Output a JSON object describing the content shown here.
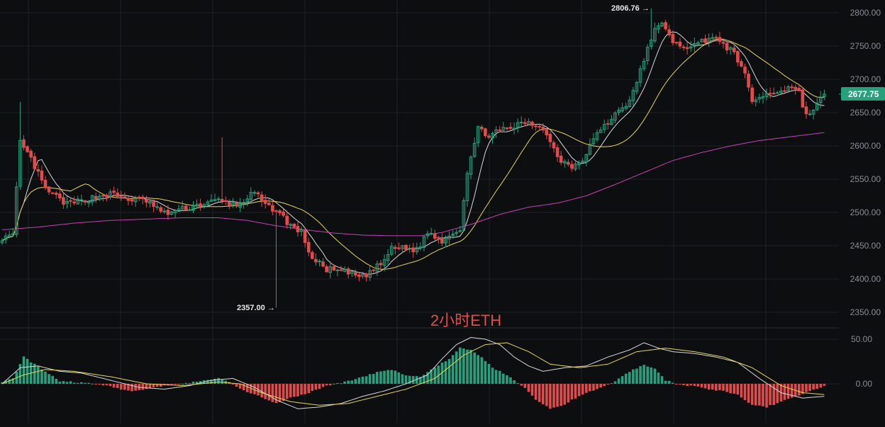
{
  "chart_data": {
    "type": "candlestick",
    "title": "2小时ETH",
    "colors": {
      "background": "#0d0e10",
      "grid": "#1e2024",
      "up": "#26a17b",
      "down": "#e04b4b",
      "ma_fast": "#d8d8d8",
      "ma_mid": "#e8d44d",
      "ma_slow": "#c740b8",
      "axis_text": "#8a8d93",
      "title": "#e04b4b"
    },
    "price_axis": {
      "ticks": [
        "2800.00",
        "2750.00",
        "2700.00",
        "2650.00",
        "2600.00",
        "2550.00",
        "2500.00",
        "2450.00",
        "2400.00",
        "2350.00"
      ],
      "ylim": [
        2326,
        2815
      ]
    },
    "macd_axis": {
      "ticks": [
        "50.00",
        "0.00"
      ],
      "ylim": [
        -38,
        65
      ]
    },
    "annotations": {
      "high_label": "2806.76 →",
      "low_label": "2357.00 →",
      "current_price": "2677.75"
    },
    "key_prices": {
      "high": 2806.76,
      "low": 2357.0,
      "current": 2677.75
    },
    "close_path": [
      [
        0,
        2462
      ],
      [
        3,
        2464
      ],
      [
        5,
        2605
      ],
      [
        8,
        2580
      ],
      [
        12,
        2535
      ],
      [
        18,
        2512
      ],
      [
        25,
        2522
      ],
      [
        30,
        2528
      ],
      [
        35,
        2520
      ],
      [
        40,
        2518
      ],
      [
        45,
        2498
      ],
      [
        50,
        2505
      ],
      [
        55,
        2512
      ],
      [
        60,
        2518
      ],
      [
        65,
        2510
      ],
      [
        70,
        2530
      ],
      [
        73,
        2510
      ],
      [
        76,
        2504
      ],
      [
        80,
        2480
      ],
      [
        83,
        2470
      ],
      [
        86,
        2430
      ],
      [
        90,
        2415
      ],
      [
        95,
        2410
      ],
      [
        100,
        2403
      ],
      [
        105,
        2422
      ],
      [
        108,
        2445
      ],
      [
        111,
        2448
      ],
      [
        115,
        2443
      ],
      [
        118,
        2470
      ],
      [
        122,
        2458
      ],
      [
        125,
        2470
      ],
      [
        127,
        2476
      ],
      [
        129,
        2562
      ],
      [
        132,
        2625
      ],
      [
        135,
        2617
      ],
      [
        140,
        2625
      ],
      [
        145,
        2635
      ],
      [
        150,
        2628
      ],
      [
        152,
        2605
      ],
      [
        155,
        2578
      ],
      [
        158,
        2570
      ],
      [
        161,
        2580
      ],
      [
        164,
        2612
      ],
      [
        168,
        2635
      ],
      [
        172,
        2660
      ],
      [
        174,
        2665
      ],
      [
        176,
        2697
      ],
      [
        178,
        2730
      ],
      [
        181,
        2773
      ],
      [
        183,
        2788
      ],
      [
        186,
        2752
      ],
      [
        188,
        2752
      ],
      [
        191,
        2748
      ],
      [
        194,
        2757
      ],
      [
        197,
        2765
      ],
      [
        200,
        2750
      ],
      [
        203,
        2742
      ],
      [
        206,
        2705
      ],
      [
        208,
        2668
      ],
      [
        211,
        2675
      ],
      [
        214,
        2680
      ],
      [
        217,
        2685
      ],
      [
        219,
        2690
      ],
      [
        221,
        2680
      ],
      [
        223,
        2645
      ],
      [
        225,
        2655
      ],
      [
        228,
        2677.75
      ]
    ],
    "macd_histogram_path": [
      [
        0,
        2
      ],
      [
        3,
        6
      ],
      [
        6,
        30
      ],
      [
        9,
        22
      ],
      [
        12,
        14
      ],
      [
        16,
        3
      ],
      [
        20,
        2
      ],
      [
        25,
        0
      ],
      [
        30,
        -3
      ],
      [
        35,
        -8
      ],
      [
        40,
        -6
      ],
      [
        45,
        -2
      ],
      [
        50,
        0
      ],
      [
        55,
        3
      ],
      [
        60,
        6
      ],
      [
        63,
        2
      ],
      [
        66,
        -6
      ],
      [
        70,
        -12
      ],
      [
        73,
        -17
      ],
      [
        76,
        -22
      ],
      [
        80,
        -16
      ],
      [
        85,
        -10
      ],
      [
        90,
        -2
      ],
      [
        95,
        2
      ],
      [
        100,
        8
      ],
      [
        105,
        14
      ],
      [
        108,
        16
      ],
      [
        112,
        9
      ],
      [
        116,
        8
      ],
      [
        120,
        18
      ],
      [
        124,
        28
      ],
      [
        127,
        40
      ],
      [
        130,
        38
      ],
      [
        133,
        30
      ],
      [
        136,
        18
      ],
      [
        140,
        10
      ],
      [
        145,
        -5
      ],
      [
        148,
        -18
      ],
      [
        152,
        -28
      ],
      [
        155,
        -25
      ],
      [
        158,
        -18
      ],
      [
        162,
        -10
      ],
      [
        166,
        -4
      ],
      [
        170,
        3
      ],
      [
        174,
        14
      ],
      [
        178,
        21
      ],
      [
        181,
        17
      ],
      [
        184,
        4
      ],
      [
        188,
        -1
      ],
      [
        192,
        -3
      ],
      [
        196,
        -6
      ],
      [
        200,
        -8
      ],
      [
        204,
        -12
      ],
      [
        208,
        -24
      ],
      [
        212,
        -26
      ],
      [
        216,
        -20
      ],
      [
        220,
        -14
      ],
      [
        224,
        -8
      ],
      [
        228,
        -3
      ]
    ],
    "macd_dif_path": [
      [
        0,
        0
      ],
      [
        5,
        18
      ],
      [
        10,
        20
      ],
      [
        16,
        14
      ],
      [
        22,
        12
      ],
      [
        30,
        4
      ],
      [
        38,
        -4
      ],
      [
        45,
        -6
      ],
      [
        52,
        -2
      ],
      [
        58,
        4
      ],
      [
        64,
        6
      ],
      [
        70,
        -4
      ],
      [
        76,
        -18
      ],
      [
        82,
        -28
      ],
      [
        88,
        -26
      ],
      [
        94,
        -22
      ],
      [
        100,
        -14
      ],
      [
        106,
        -8
      ],
      [
        112,
        0
      ],
      [
        118,
        10
      ],
      [
        122,
        28
      ],
      [
        126,
        44
      ],
      [
        130,
        52
      ],
      [
        134,
        50
      ],
      [
        138,
        44
      ],
      [
        142,
        30
      ],
      [
        146,
        20
      ],
      [
        150,
        14
      ],
      [
        156,
        18
      ],
      [
        162,
        20
      ],
      [
        168,
        30
      ],
      [
        174,
        38
      ],
      [
        178,
        46
      ],
      [
        182,
        40
      ],
      [
        186,
        36
      ],
      [
        192,
        34
      ],
      [
        198,
        30
      ],
      [
        204,
        24
      ],
      [
        210,
        6
      ],
      [
        216,
        -10
      ],
      [
        222,
        -16
      ],
      [
        228,
        -14
      ]
    ],
    "macd_dea_path": [
      [
        0,
        0
      ],
      [
        6,
        10
      ],
      [
        12,
        16
      ],
      [
        20,
        14
      ],
      [
        30,
        8
      ],
      [
        40,
        0
      ],
      [
        50,
        -2
      ],
      [
        60,
        2
      ],
      [
        66,
        0
      ],
      [
        72,
        -10
      ],
      [
        80,
        -20
      ],
      [
        88,
        -24
      ],
      [
        96,
        -22
      ],
      [
        104,
        -14
      ],
      [
        112,
        -6
      ],
      [
        120,
        6
      ],
      [
        128,
        32
      ],
      [
        134,
        44
      ],
      [
        140,
        46
      ],
      [
        146,
        36
      ],
      [
        152,
        22
      ],
      [
        160,
        18
      ],
      [
        168,
        22
      ],
      [
        176,
        36
      ],
      [
        184,
        40
      ],
      [
        192,
        36
      ],
      [
        200,
        30
      ],
      [
        208,
        18
      ],
      [
        216,
        -2
      ],
      [
        222,
        -10
      ],
      [
        228,
        -12
      ]
    ],
    "ma_slow_path": [
      [
        0,
        2474
      ],
      [
        10,
        2478
      ],
      [
        20,
        2484
      ],
      [
        30,
        2488
      ],
      [
        40,
        2490
      ],
      [
        50,
        2492
      ],
      [
        60,
        2492
      ],
      [
        68,
        2488
      ],
      [
        76,
        2480
      ],
      [
        84,
        2474
      ],
      [
        92,
        2469
      ],
      [
        100,
        2466
      ],
      [
        108,
        2465
      ],
      [
        116,
        2465
      ],
      [
        122,
        2470
      ],
      [
        130,
        2482
      ],
      [
        138,
        2497
      ],
      [
        146,
        2508
      ],
      [
        154,
        2514
      ],
      [
        162,
        2525
      ],
      [
        170,
        2542
      ],
      [
        178,
        2560
      ],
      [
        186,
        2578
      ],
      [
        194,
        2590
      ],
      [
        202,
        2600
      ],
      [
        210,
        2608
      ],
      [
        216,
        2612
      ],
      [
        222,
        2616
      ],
      [
        228,
        2620
      ]
    ]
  }
}
